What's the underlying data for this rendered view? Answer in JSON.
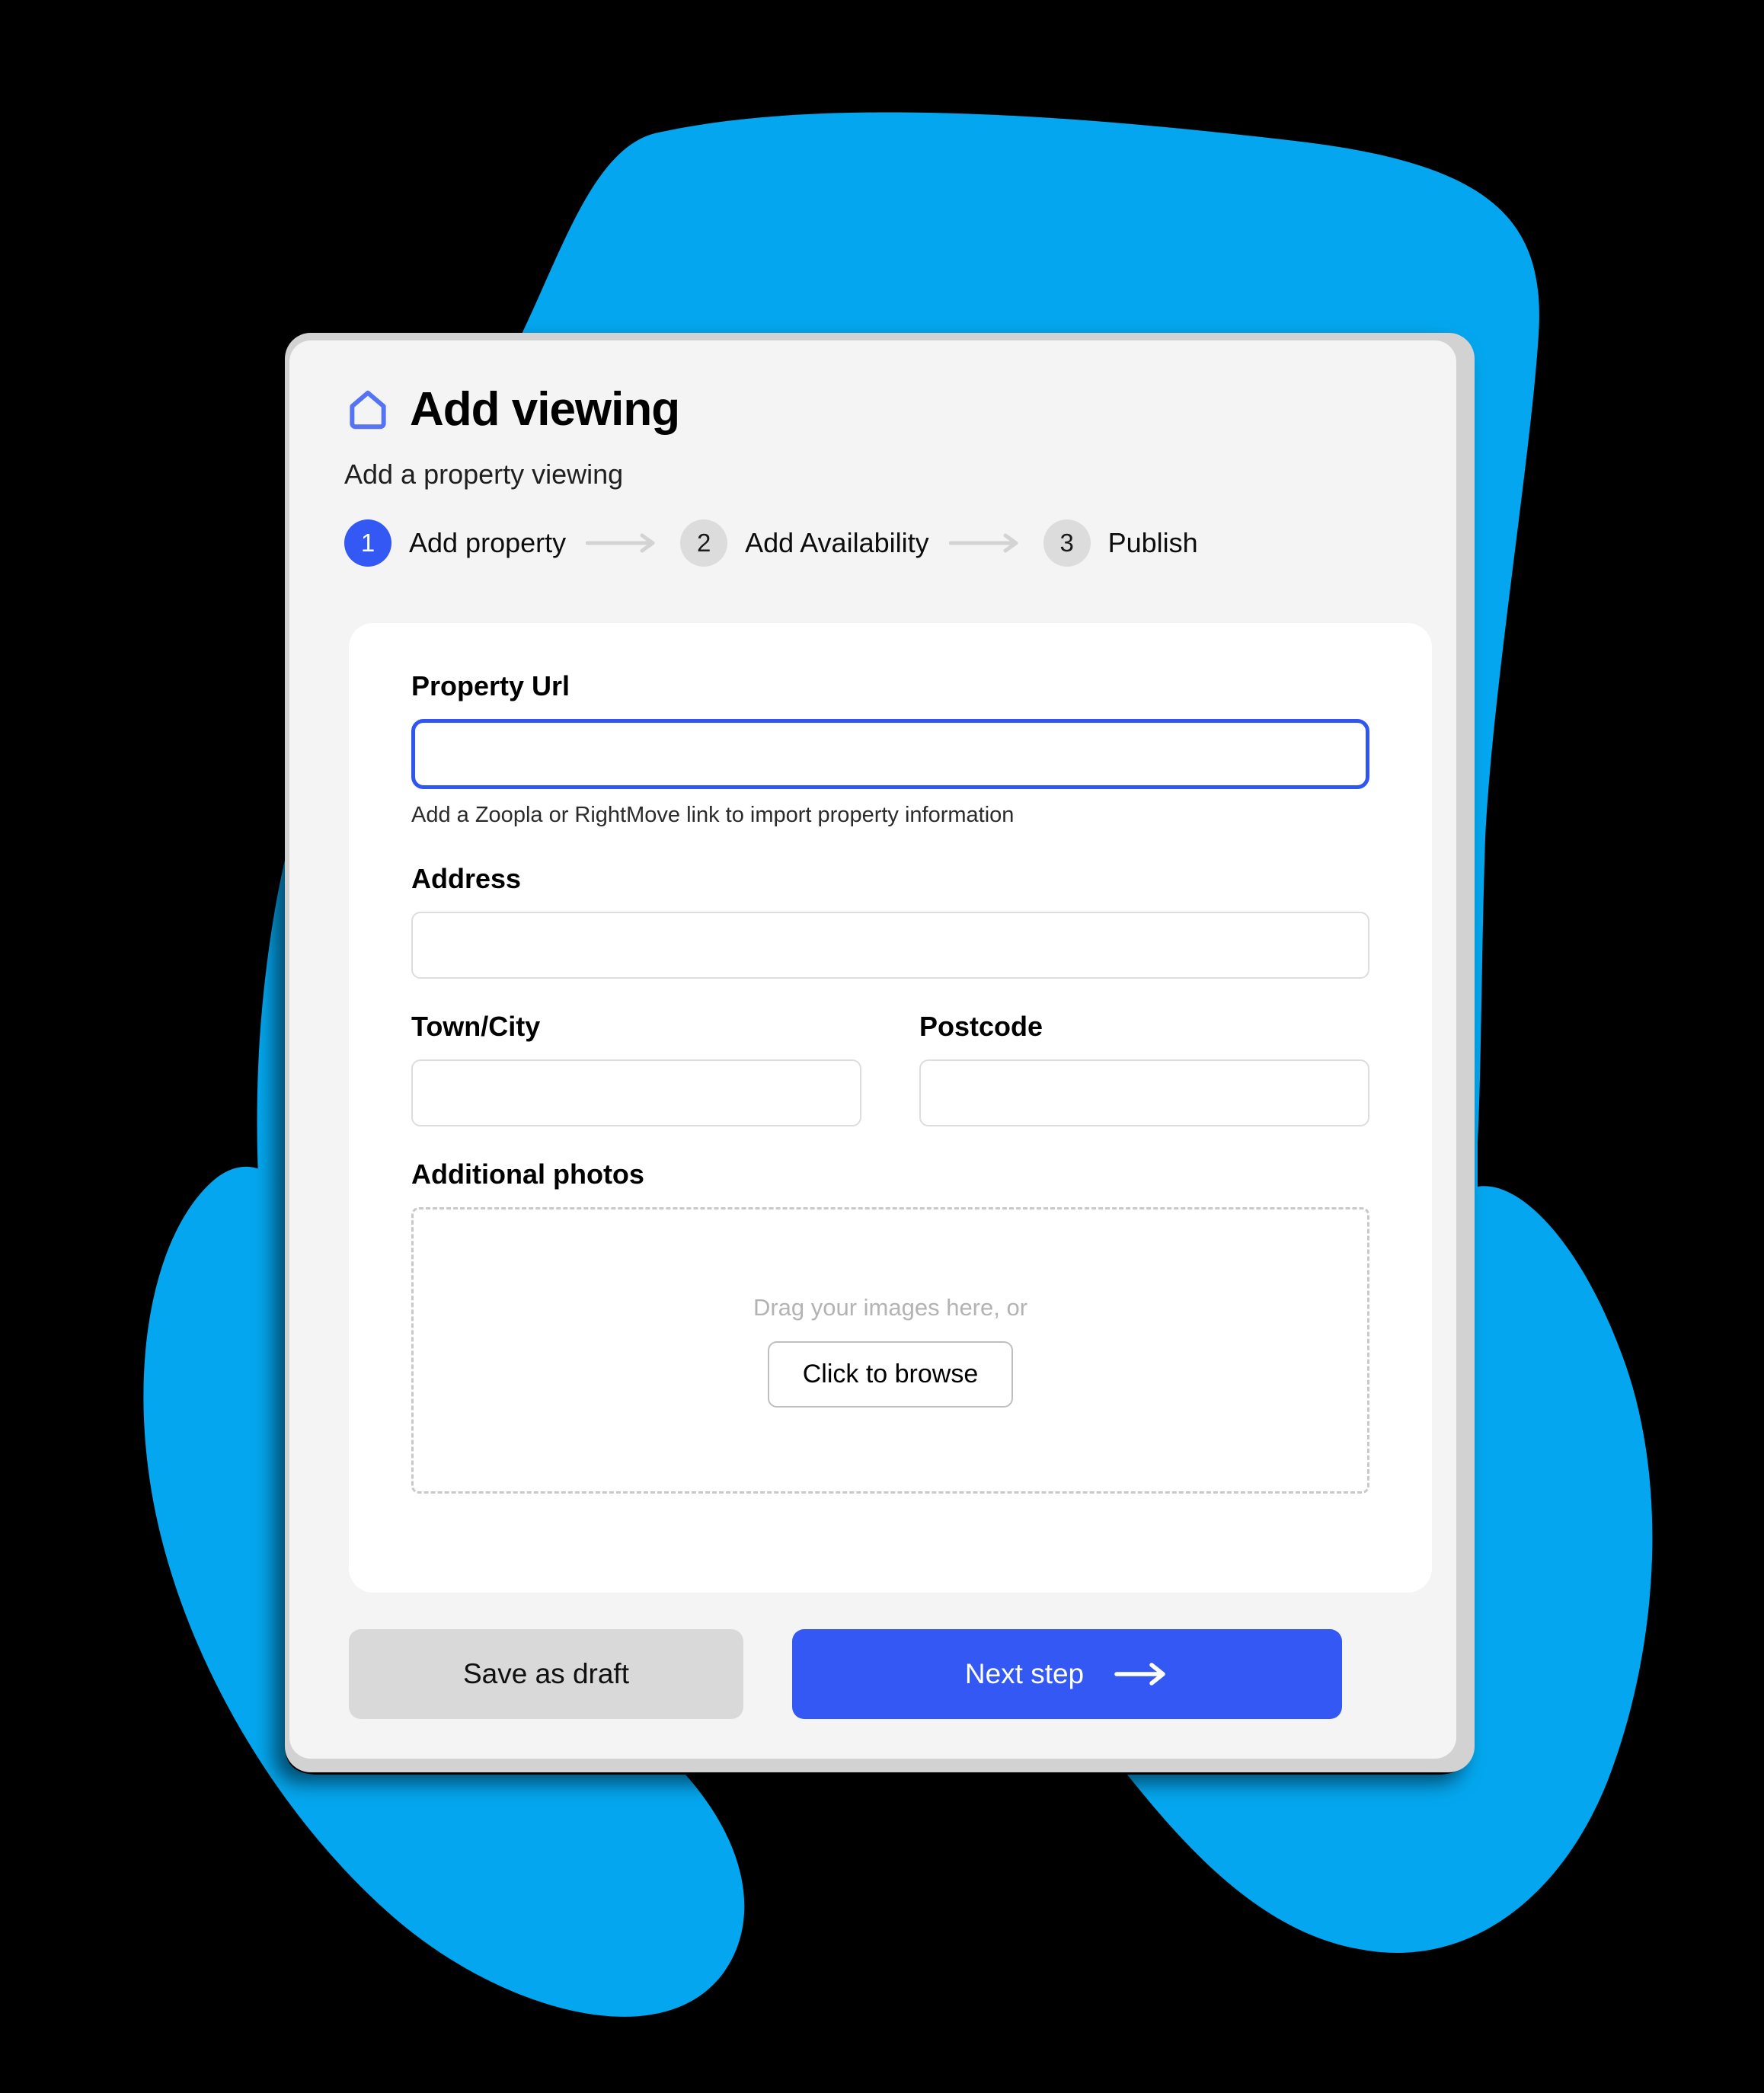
{
  "theme": {
    "page_background": "#000000",
    "blob_color": "#04a7ef",
    "primary_blue": "#3358f4",
    "icon_blue": "#5573f5",
    "card_background": "#f4f4f5",
    "panel_background": "#ffffff",
    "frame_gray": "#d2d2d2",
    "input_border": "#dddddd",
    "focus_border": "#2f55f2",
    "muted_text": "#b3b3b3",
    "draft_button_bg": "#d9d9d9"
  },
  "header": {
    "icon": "home-icon",
    "title": "Add viewing",
    "subtitle": "Add a property viewing"
  },
  "stepper": {
    "steps": [
      {
        "number": "1",
        "label": "Add property",
        "state": "active"
      },
      {
        "number": "2",
        "label": "Add Availability",
        "state": "inactive"
      },
      {
        "number": "3",
        "label": "Publish",
        "state": "inactive"
      }
    ],
    "separator_icon": "arrow-right-icon"
  },
  "form": {
    "property_url": {
      "label": "Property Url",
      "value": "",
      "placeholder": "",
      "helper": "Add a Zoopla or RightMove link to import property information",
      "focused": true
    },
    "address": {
      "label": "Address",
      "value": "",
      "placeholder": ""
    },
    "town_city": {
      "label": "Town/City",
      "value": "",
      "placeholder": ""
    },
    "postcode": {
      "label": "Postcode",
      "value": "",
      "placeholder": ""
    },
    "additional_photos": {
      "label": "Additional photos",
      "drag_text": "Drag your images here, or",
      "browse_button": "Click to browse"
    }
  },
  "footer": {
    "save_draft_label": "Save as draft",
    "next_step_label": "Next step",
    "next_step_icon": "arrow-right-icon"
  }
}
